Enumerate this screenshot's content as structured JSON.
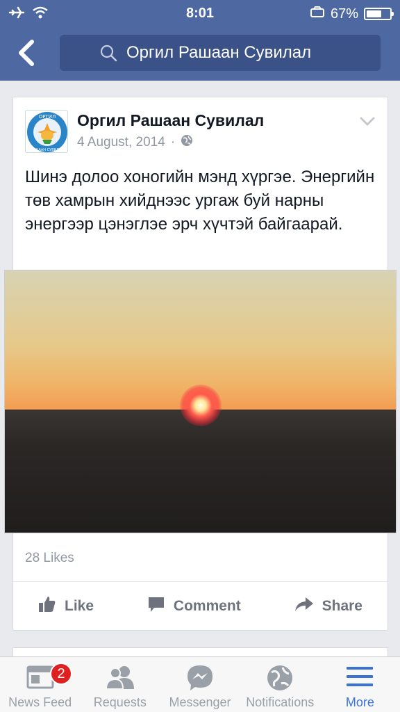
{
  "status_bar": {
    "time": "8:01",
    "battery": "67%",
    "battery_level": 0.67
  },
  "nav": {
    "search_text": "Оргил Рашаан Сувилал"
  },
  "post": {
    "page_name": "Оргил Рашаан Сувилал",
    "date": "4 August, 2014",
    "separator": "·",
    "text": "Шинэ долоо хоногийн мэнд хүргэе. Энергийн төв хамрын хийднээс ургаж буй нарны энергээр цэнэглэе эрч хүчтэй байгаарай.",
    "likes": "28 Likes",
    "actions": {
      "like": "Like",
      "comment": "Comment",
      "share": "Share"
    },
    "avatar_text_top": "ОРГИЛ",
    "avatar_text_bottom": "РАШААН СУВИЛАЛ"
  },
  "tabbar": {
    "news_feed": "News Feed",
    "news_feed_badge": "2",
    "requests": "Requests",
    "messenger": "Messenger",
    "notifications": "Notifications",
    "more": "More"
  },
  "colors": {
    "nav": "#4e69a2",
    "active_tab": "#3b73d5",
    "badge": "#e02020"
  }
}
